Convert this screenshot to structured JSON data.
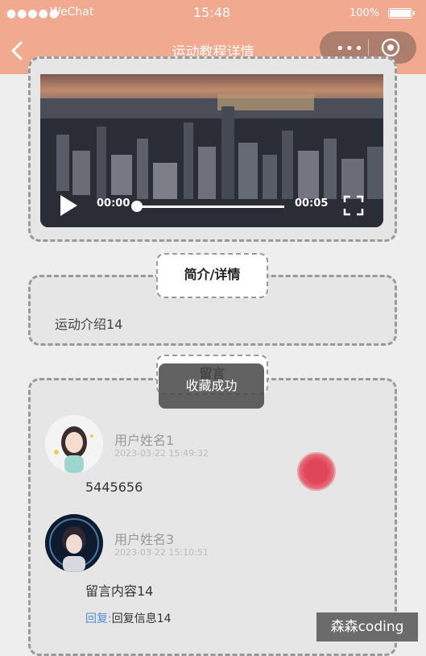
{
  "status_bar": {
    "signal": "●●●●●",
    "carrier": "WeChat",
    "time": "15:48",
    "battery": "100%"
  },
  "nav": {
    "title": "运动教程详情",
    "more": "•••",
    "accent": "#f1a98f"
  },
  "video": {
    "current_time": "00:00",
    "duration": "00:05",
    "progress": 0
  },
  "intro": {
    "tag": "简介/详情",
    "text": "运动介绍14"
  },
  "comments": {
    "tag": "留言",
    "toast": "收藏成功",
    "items": [
      {
        "name": "用户姓名1",
        "time": "2023-03-22 15:49:32",
        "content": "5445656"
      },
      {
        "name": "用户姓名3",
        "time": "2023-03-22 15:10:51",
        "content": "留言内容14",
        "reply_label": "回复:",
        "reply": "回复信息14"
      }
    ]
  },
  "watermark": "森森coding"
}
